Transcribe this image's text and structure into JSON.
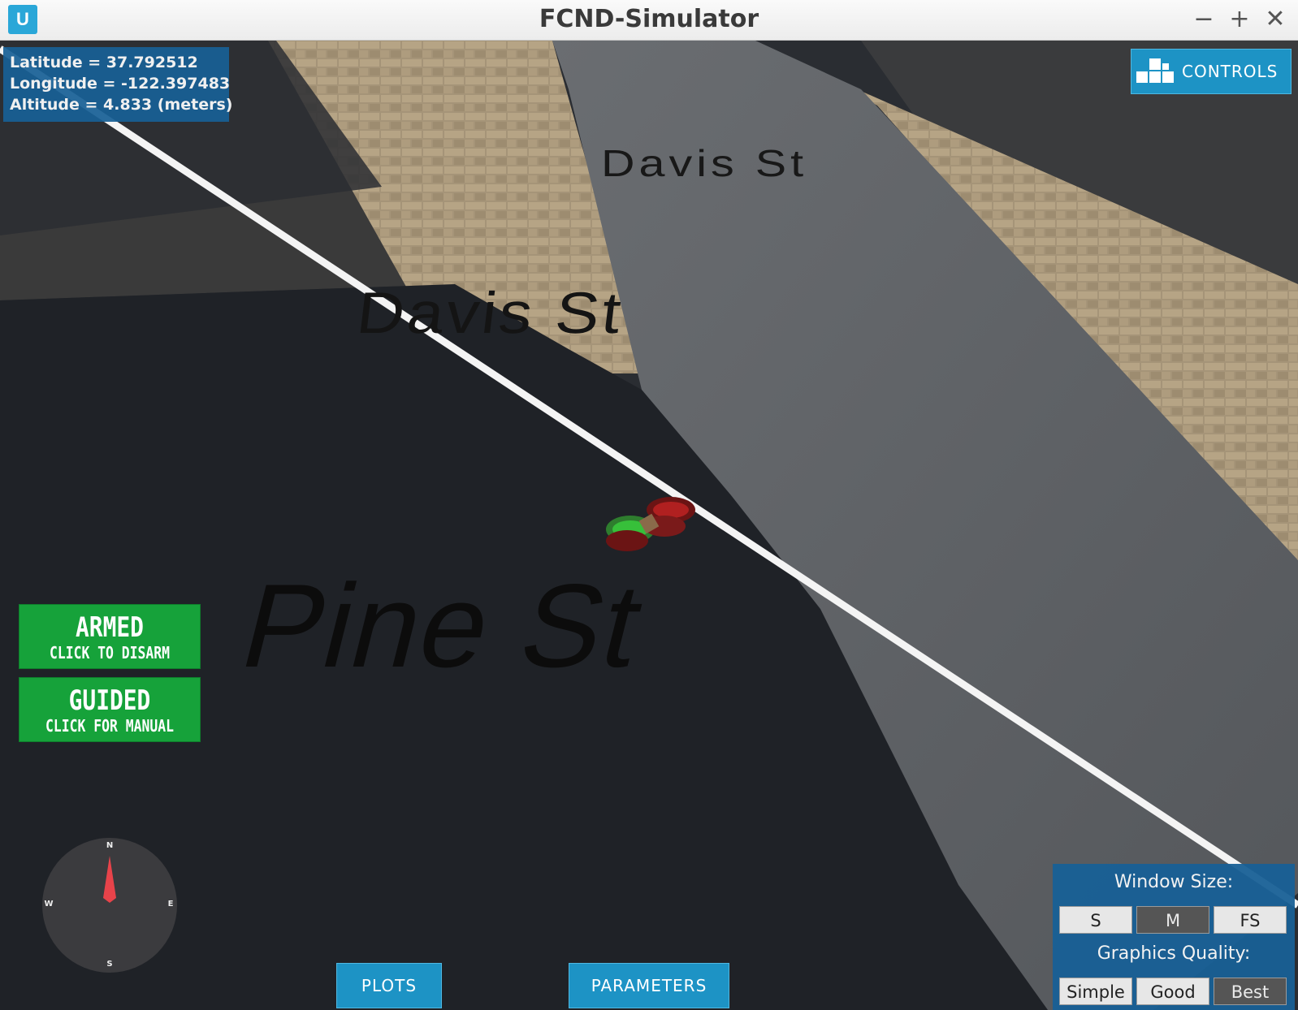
{
  "window": {
    "title": "FCND-Simulator",
    "app_icon": "udacity-logo-icon",
    "minimize_symbol": "−",
    "maximize_symbol": "+",
    "close_symbol": "✕"
  },
  "telemetry": {
    "latitude": "Latitude = 37.792512",
    "longitude": "Longitude = -122.397483",
    "altitude": "Altitude = 4.833 (meters)"
  },
  "controls_button": {
    "label": "CONTROLS",
    "icon": "controls-blocks-icon"
  },
  "streets": {
    "far": "Davis St",
    "near": "Davis St",
    "main": "Pine St"
  },
  "mode_buttons": {
    "armed": {
      "main": "ARMED",
      "sub": "CLICK TO DISARM"
    },
    "guided": {
      "main": "GUIDED",
      "sub": "CLICK FOR MANUAL"
    }
  },
  "compass": {
    "north": "N",
    "south": "S",
    "west": "W",
    "east": "E"
  },
  "bottom_buttons": {
    "plots": "PLOTS",
    "parameters": "PARAMETERS"
  },
  "settings": {
    "window_size_label": "Window Size:",
    "window_size_options": [
      "S",
      "M",
      "FS"
    ],
    "window_size_selected": "M",
    "graphics_quality_label": "Graphics Quality:",
    "graphics_quality_options": [
      "Simple",
      "Good",
      "Best"
    ],
    "graphics_quality_selected": "Best"
  },
  "colors": {
    "panel_blue": "#1860a0",
    "button_blue": "#1d93c5",
    "mode_green": "#16a23a",
    "road_gray": "#5c5f63",
    "shadow": "#1f2227",
    "sidewalk": "#a8967a"
  }
}
